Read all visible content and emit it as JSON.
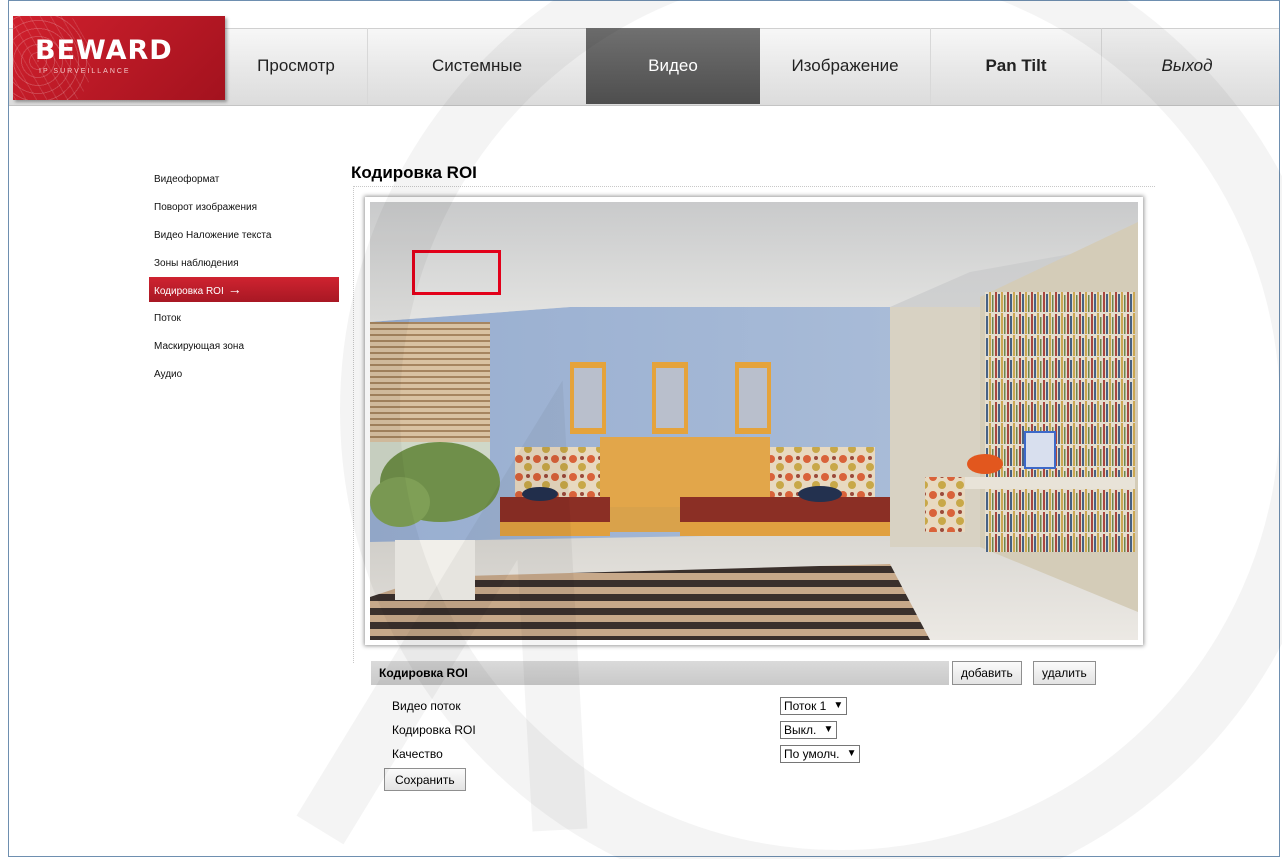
{
  "brand": {
    "name": "BEWARD",
    "tagline": "IP SURVEILLANCE",
    "color": "#c41e2a"
  },
  "nav": {
    "items": [
      {
        "label": "Просмотр",
        "active": false
      },
      {
        "label": "Системные",
        "active": false
      },
      {
        "label": "Видео",
        "active": true
      },
      {
        "label": "Изображение",
        "active": false
      },
      {
        "label": "Pan Tilt",
        "active": false
      },
      {
        "label": "Выход",
        "active": false
      }
    ]
  },
  "sidebar": {
    "items": [
      {
        "label": "Видеоформат"
      },
      {
        "label": "Поворот изображения"
      },
      {
        "label": "Видео Наложение текста"
      },
      {
        "label": "Зоны наблюдения"
      },
      {
        "label": "Кодировка ROI",
        "active": true,
        "arrow": "→"
      },
      {
        "label": "Поток"
      },
      {
        "label": "Маскирующая зона"
      },
      {
        "label": "Аудио"
      }
    ]
  },
  "page": {
    "title": "Кодировка ROI"
  },
  "roi_panel": {
    "header": "Кодировка ROI",
    "add_label": "добавить",
    "delete_label": "удалить",
    "fields": {
      "stream": {
        "label": "Видео поток",
        "value": "Поток 1"
      },
      "roi": {
        "label": "Кодировка ROI",
        "value": "Выкл."
      },
      "quality": {
        "label": "Качество",
        "value": "По умолч."
      }
    },
    "save_label": "Сохранить"
  },
  "icons": {
    "dropdown": "chevron-down-icon",
    "arrow": "arrow-right-icon"
  },
  "colors": {
    "accent": "#c41e2a",
    "roi_box": "#e2001a",
    "active_tab": "#5a5a5a"
  }
}
